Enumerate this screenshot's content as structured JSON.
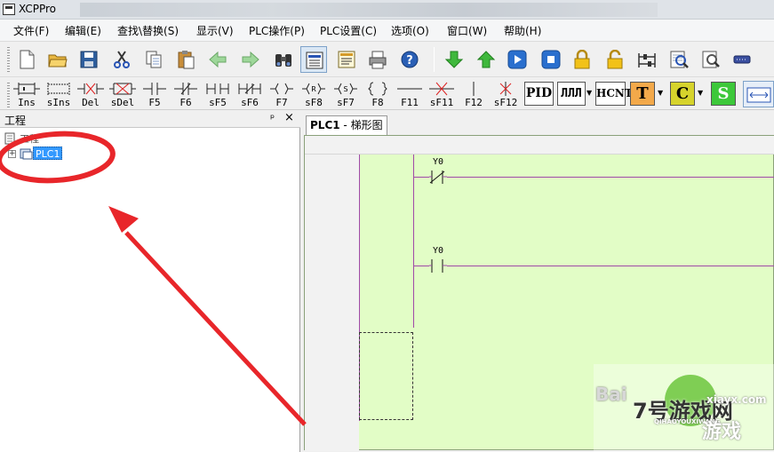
{
  "window": {
    "title": "XCPPro"
  },
  "menu": [
    "文件(F)",
    "编辑(E)",
    "查找\\替换(S)",
    "显示(V)",
    "PLC操作(P)",
    "PLC设置(C)",
    "选项(O)",
    "窗口(W)",
    "帮助(H)"
  ],
  "toolbar_icons": [
    "new-file-icon",
    "open-folder-icon",
    "save-icon",
    "cut-icon",
    "copy-icon",
    "paste-icon",
    "back-arrow-icon",
    "forward-arrow-icon",
    "find-binoculars-icon",
    "ladder-view-icon",
    "instruction-list-icon",
    "print-icon",
    "help-icon",
    "download-icon",
    "upload-icon",
    "run-icon",
    "stop-icon",
    "lock-icon",
    "unlock-icon",
    "monitor-icon",
    "zoom-icon",
    "search-doc-icon",
    "comm-port-icon"
  ],
  "ladder_buttons": [
    {
      "label": "Ins",
      "icon": "insert-icon"
    },
    {
      "label": "sIns",
      "icon": "shift-insert-icon"
    },
    {
      "label": "Del",
      "icon": "delete-icon"
    },
    {
      "label": "sDel",
      "icon": "shift-delete-icon"
    },
    {
      "label": "F5",
      "icon": "no-contact-icon"
    },
    {
      "label": "F6",
      "icon": "nc-contact-icon"
    },
    {
      "label": "sF5",
      "icon": "parallel-no-icon"
    },
    {
      "label": "sF6",
      "icon": "parallel-nc-icon"
    },
    {
      "label": "F7",
      "icon": "coil-icon"
    },
    {
      "label": "sF8",
      "icon": "reset-coil-icon"
    },
    {
      "label": "sF7",
      "icon": "set-coil-icon"
    },
    {
      "label": "F8",
      "icon": "instruction-icon"
    },
    {
      "label": "F11",
      "icon": "hline-icon"
    },
    {
      "label": "sF11",
      "icon": "delete-line-icon"
    },
    {
      "label": "F12",
      "icon": "vline-icon"
    },
    {
      "label": "sF12",
      "icon": "delete-vline-icon"
    }
  ],
  "special_buttons": {
    "pid": "PID",
    "pulse": "ЛЛЛ",
    "hcnt": "HCNT",
    "timer": "T",
    "counter": "C",
    "s": "S"
  },
  "colors": {
    "ladder_bg": "#e2fdc6",
    "rung_line": "#a04aa8",
    "annotation": "#e8262a",
    "selection": "#3399ff"
  },
  "project_panel": {
    "title": "工程",
    "pin": "ᵖ",
    "close": "×",
    "root_label": "工程",
    "plc_label": "PLC1"
  },
  "editor": {
    "tab_plc": "PLC1",
    "tab_rest": " - 梯形图",
    "rungs": [
      {
        "contact": "Y0",
        "type": "normally-closed"
      },
      {
        "contact": "Y0",
        "type": "normally-open"
      }
    ]
  },
  "watermark": {
    "baidu": "Bai",
    "site": "7号游戏网",
    "domain": "xiayx.com",
    "pinyin": "QIHAOYOUXIWANG",
    "sub": "游戏"
  }
}
